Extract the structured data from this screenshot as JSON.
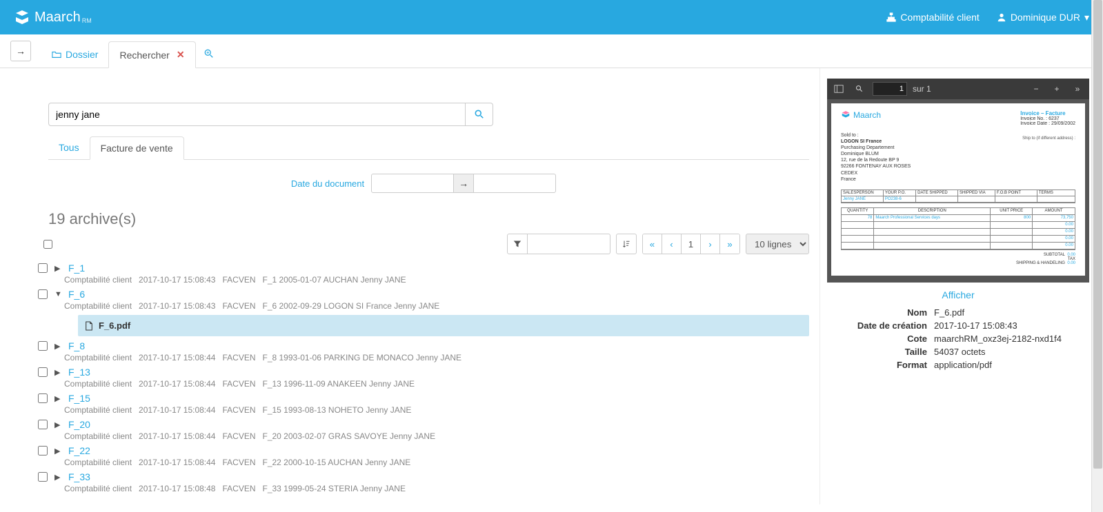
{
  "header": {
    "brand": "Maarch",
    "brand_sub": "RM",
    "nav_account": "Comptabilité client",
    "nav_user": "Dominique DUR"
  },
  "tabs": {
    "dossier": "Dossier",
    "rechercher": "Rechercher"
  },
  "search": {
    "value": "jenny jane"
  },
  "subtabs": {
    "tous": "Tous",
    "facture": "Facture de vente"
  },
  "filters": {
    "date_label": "Date du document",
    "date_from": "",
    "date_to": ""
  },
  "results": {
    "count_label": "19 archive(s)",
    "page": "1",
    "lines_label": "10 lignes",
    "items": [
      {
        "id": "F_1",
        "org": "Comptabilité client",
        "date": "2017-10-17 15:08:43",
        "type": "FACVEN",
        "desc": "F_1 2005-01-07 AUCHAN Jenny JANE",
        "expanded": false
      },
      {
        "id": "F_6",
        "org": "Comptabilité client",
        "date": "2017-10-17 15:08:43",
        "type": "FACVEN",
        "desc": "F_6 2002-09-29 LOGON SI France Jenny JANE",
        "expanded": true,
        "file": "F_6.pdf"
      },
      {
        "id": "F_8",
        "org": "Comptabilité client",
        "date": "2017-10-17 15:08:44",
        "type": "FACVEN",
        "desc": "F_8 1993-01-06 PARKING DE MONACO Jenny JANE",
        "expanded": false
      },
      {
        "id": "F_13",
        "org": "Comptabilité client",
        "date": "2017-10-17 15:08:44",
        "type": "FACVEN",
        "desc": "F_13 1996-11-09 ANAKEEN Jenny JANE",
        "expanded": false
      },
      {
        "id": "F_15",
        "org": "Comptabilité client",
        "date": "2017-10-17 15:08:44",
        "type": "FACVEN",
        "desc": "F_15 1993-08-13 NOHETO Jenny JANE",
        "expanded": false
      },
      {
        "id": "F_20",
        "org": "Comptabilité client",
        "date": "2017-10-17 15:08:44",
        "type": "FACVEN",
        "desc": "F_20 2003-02-07 GRAS SAVOYE Jenny JANE",
        "expanded": false
      },
      {
        "id": "F_22",
        "org": "Comptabilité client",
        "date": "2017-10-17 15:08:44",
        "type": "FACVEN",
        "desc": "F_22 2000-10-15 AUCHAN Jenny JANE",
        "expanded": false
      },
      {
        "id": "F_33",
        "org": "Comptabilité client",
        "date": "2017-10-17 15:08:48",
        "type": "FACVEN",
        "desc": "F_33 1999-05-24 STERIA Jenny JANE",
        "expanded": false
      }
    ]
  },
  "preview": {
    "pdf_toolbar": {
      "page_input": "1",
      "page_total": "sur 1"
    },
    "doc": {
      "brand": "Maarch",
      "title": "Invoice – Facture",
      "invoice_no": "Invoice No. : 6237",
      "invoice_date": "Invoice Date : 29/09/2002",
      "sold_to_label": "Sold to :",
      "sold_to_name": "LOGON SI France",
      "sold_to_dept": "Purchasing Departement",
      "sold_to_contact": "Dominique BLUM",
      "sold_to_addr1": "12, rue de la Redoute BP 9",
      "sold_to_addr2": "92266 FONTENAY AUX ROSES",
      "sold_to_addr3": "CEDEX",
      "sold_to_country": "France",
      "ship_to": "Ship to (if different address) :",
      "t1_headers": [
        "SALESPERSON",
        "YOUR P.O.",
        "DATE SHIPPED",
        "SHIPPED VIA",
        "F.O.B POINT",
        "TERMS"
      ],
      "t1_row": [
        "Jenny JANE",
        "PO238-6",
        "",
        "",
        "",
        ""
      ],
      "t2_headers": [
        "QUANTITY",
        "DESCRIPTION",
        "UNIT PRICE",
        "AMOUNT"
      ],
      "t2_row": [
        "78",
        "Maarch Professional Services days",
        "800",
        "73,750"
      ],
      "subtotal_label": "SUBTOTAL",
      "tax_label": "TAX",
      "ship_label": "SHIPPING & HANDELING"
    },
    "afficher": "Afficher",
    "meta": [
      {
        "label": "Nom",
        "value": "F_6.pdf"
      },
      {
        "label": "Date de création",
        "value": "2017-10-17 15:08:43"
      },
      {
        "label": "Cote",
        "value": "maarchRM_oxz3ej-2182-nxd1f4"
      },
      {
        "label": "Taille",
        "value": "54037 octets"
      },
      {
        "label": "Format",
        "value": "application/pdf"
      }
    ]
  }
}
